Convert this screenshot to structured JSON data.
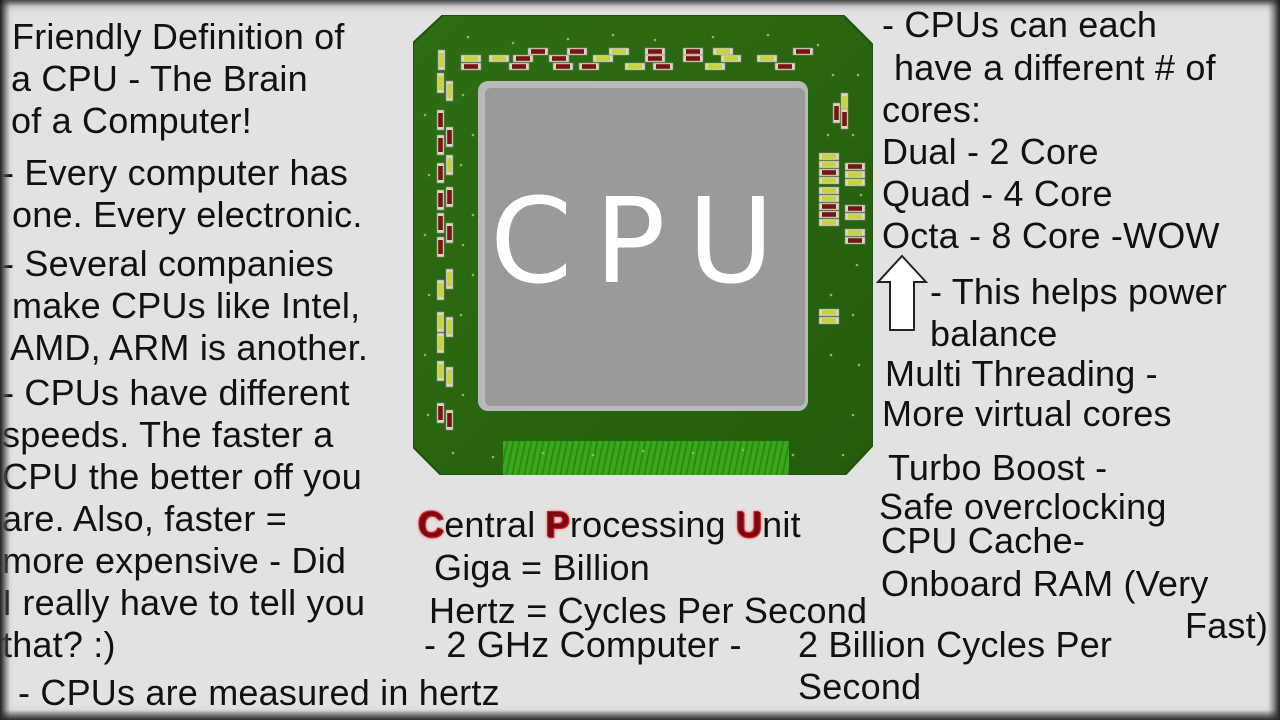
{
  "left_column": {
    "title_lines": [
      "Friendly Definition of",
      "a CPU - The Brain",
      "of a Computer!"
    ],
    "point1_lines": [
      "- Every computer has",
      "one. Every electronic."
    ],
    "point2_lines": [
      "- Several companies",
      "make CPUs like Intel,",
      "AMD, ARM is another."
    ],
    "point3_lines": [
      "- CPUs have different",
      "speeds. The faster a",
      "CPU the better off you",
      "are. Also, faster =",
      "more expensive - Did",
      "I really have to tell you",
      "that? :)"
    ],
    "point4": "- CPUs are measured in hertz"
  },
  "chip": {
    "label": "CPU",
    "colors": {
      "board": "#2b6a12",
      "board_edge": "#1f5a0b",
      "die": "#9a9a9a",
      "die_rim": "#bdbdbd",
      "pins": "#3aa81c",
      "component_red": "#7a1410",
      "component_yellow": "#c8d23a"
    }
  },
  "center_column": {
    "acronym": {
      "parts": [
        {
          "initial": "C",
          "rest": "entral "
        },
        {
          "initial": "P",
          "rest": "rocessing "
        },
        {
          "initial": "U",
          "rest": "nit"
        }
      ],
      "highlight_color": "#e0202a"
    },
    "giga": "Giga = Billion",
    "hertz": "Hertz = Cycles Per Second",
    "ghz_example_a": "- 2 GHz Computer -",
    "ghz_example_b_lines": [
      "2 Billion Cycles Per",
      "Second"
    ]
  },
  "right_column": {
    "cores_lines": [
      "- CPUs can each",
      "have a different # of",
      "cores:"
    ],
    "core_types": [
      "Dual - 2 Core",
      "Quad - 4 Core",
      "Octa - 8 Core -WOW"
    ],
    "arrow_icon": "up-arrow",
    "power_balance_lines": [
      "- This helps power",
      "balance"
    ],
    "multithreading_lines": [
      "Multi Threading -",
      "More virtual cores"
    ],
    "turbo_lines": [
      "Turbo Boost -",
      "Safe overclocking"
    ],
    "cache_lines": [
      "CPU Cache-",
      "Onboard RAM (Very",
      "Fast)"
    ]
  }
}
